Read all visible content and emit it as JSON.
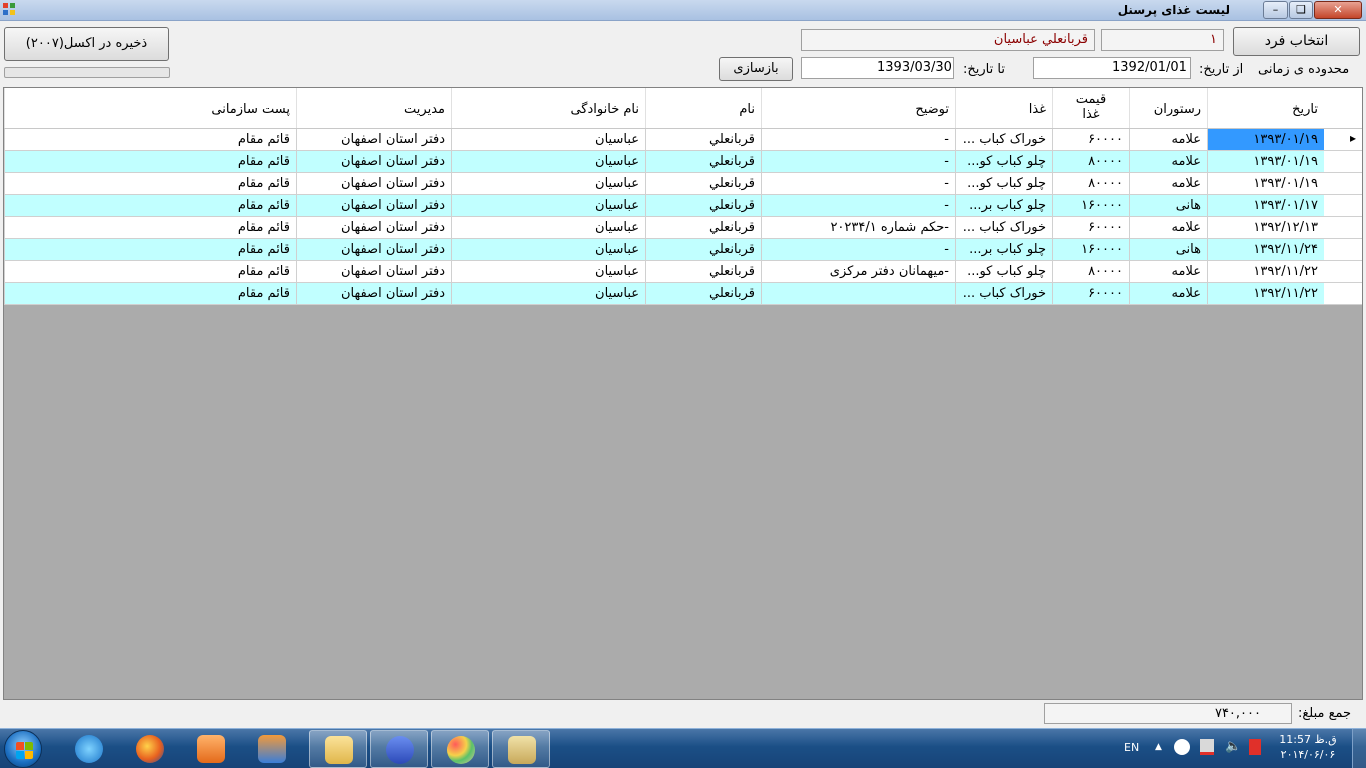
{
  "window": {
    "title": "لیست غذای پرسنل"
  },
  "controls": {
    "select_person_label": "انتخاب فرد",
    "person_id": "۱",
    "person_name": "قربانعلي عباسيان",
    "save_excel_label": "ذخیره در اکسل(۲۰۰۷)",
    "time_range_label": "محدوده ی زمانی",
    "from_label": "از تاریخ:",
    "from_value": "1392/01/01",
    "to_label": "تا تاریخ:",
    "to_value": "1393/03/30",
    "reload_label": "بازسازی"
  },
  "table": {
    "headers": {
      "date": "تاریخ",
      "restaurant": "رستوران",
      "price1": "قیمت",
      "price2": "غذا",
      "food": "غذا",
      "desc": "توضیح",
      "name": "نام",
      "family": "نام خانوادگی",
      "management": "مدیریت",
      "post": "پست سازمانی"
    },
    "rows": [
      {
        "date": "۱۳۹۳/۰۱/۱۹",
        "restaurant": "علامه",
        "price": "۶۰۰۰۰",
        "food": "خوراک کباب ...",
        "desc": "-",
        "name": "قربانعلي",
        "family": "عباسيان",
        "management": "دفتر استان اصفهان",
        "post": "قائم مقام"
      },
      {
        "date": "۱۳۹۳/۰۱/۱۹",
        "restaurant": "علامه",
        "price": "۸۰۰۰۰",
        "food": "چلو کباب کو...",
        "desc": "-",
        "name": "قربانعلي",
        "family": "عباسيان",
        "management": "دفتر استان اصفهان",
        "post": "قائم مقام"
      },
      {
        "date": "۱۳۹۳/۰۱/۱۹",
        "restaurant": "علامه",
        "price": "۸۰۰۰۰",
        "food": "چلو کباب کو...",
        "desc": "-",
        "name": "قربانعلي",
        "family": "عباسيان",
        "management": "دفتر استان اصفهان",
        "post": "قائم مقام"
      },
      {
        "date": "۱۳۹۳/۰۱/۱۷",
        "restaurant": "هانی",
        "price": "۱۶۰۰۰۰",
        "food": "چلو کباب بر...",
        "desc": "-",
        "name": "قربانعلي",
        "family": "عباسيان",
        "management": "دفتر استان اصفهان",
        "post": "قائم مقام"
      },
      {
        "date": "۱۳۹۲/۱۲/۱۳",
        "restaurant": "علامه",
        "price": "۶۰۰۰۰",
        "food": "خوراک کباب ...",
        "desc": "-حکم شماره ۲۰۲۳۴/۱",
        "name": "قربانعلي",
        "family": "عباسيان",
        "management": "دفتر استان اصفهان",
        "post": "قائم مقام"
      },
      {
        "date": "۱۳۹۲/۱۱/۲۴",
        "restaurant": "هانی",
        "price": "۱۶۰۰۰۰",
        "food": "چلو کباب بر...",
        "desc": "-",
        "name": "قربانعلي",
        "family": "عباسيان",
        "management": "دفتر استان اصفهان",
        "post": "قائم مقام"
      },
      {
        "date": "۱۳۹۲/۱۱/۲۲",
        "restaurant": "علامه",
        "price": "۸۰۰۰۰",
        "food": "چلو کباب کو...",
        "desc": "-میهمانان دفتر مرکزی",
        "name": "قربانعلي",
        "family": "عباسيان",
        "management": "دفتر استان اصفهان",
        "post": "قائم مقام"
      },
      {
        "date": "۱۳۹۲/۱۱/۲۲",
        "restaurant": "علامه",
        "price": "۶۰۰۰۰",
        "food": "خوراک کباب ...",
        "desc": "",
        "name": "قربانعلي",
        "family": "عباسيان",
        "management": "دفتر استان اصفهان",
        "post": "قائم مقام"
      }
    ]
  },
  "status": {
    "total_label": "جمع مبلغ:",
    "total_value": "۷۴۰,۰۰۰"
  },
  "taskbar": {
    "items": [
      "internet-explorer",
      "firefox",
      "media-player",
      "remote-desktop",
      "file-explorer",
      "infinity-app",
      "paint",
      "food-app"
    ],
    "language": "EN",
    "time": "ق.ظ 11:57",
    "date": "۲۰۱۴/۰۶/۰۶"
  },
  "colors": {
    "alt_row": "#c1ffff",
    "selected_cell": "#3399ff",
    "grid_bg": "#ababab",
    "name_text": "#8b0000"
  }
}
